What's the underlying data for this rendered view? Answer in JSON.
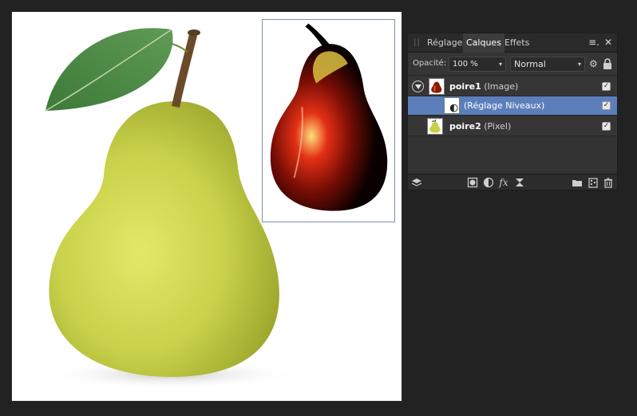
{
  "panel": {
    "grip": "||",
    "tabs": [
      {
        "label": "Réglage",
        "active": false
      },
      {
        "label": "Calques",
        "active": true
      },
      {
        "label": "Effets",
        "active": false
      }
    ],
    "menu_icon": "≡.",
    "close_icon": "✕",
    "opacity_label": "Opacité:",
    "opacity_value": "100 %",
    "blend_mode": "Normal",
    "layers": [
      {
        "name": "poire1",
        "type": "(Image)",
        "visible": true,
        "expanded": true
      },
      {
        "name": "",
        "type": "(Réglage Niveaux)",
        "visible": true,
        "selected": true
      },
      {
        "name": "poire2",
        "type": "(Pixel)",
        "visible": true
      }
    ],
    "checkmark": "✓"
  },
  "icons": {
    "gear": "⚙",
    "fx": "fx",
    "dropdown": "▾"
  },
  "colors": {
    "selected_row": "#5c7fbb",
    "panel_bg": "#333333",
    "app_bg": "#222222"
  }
}
